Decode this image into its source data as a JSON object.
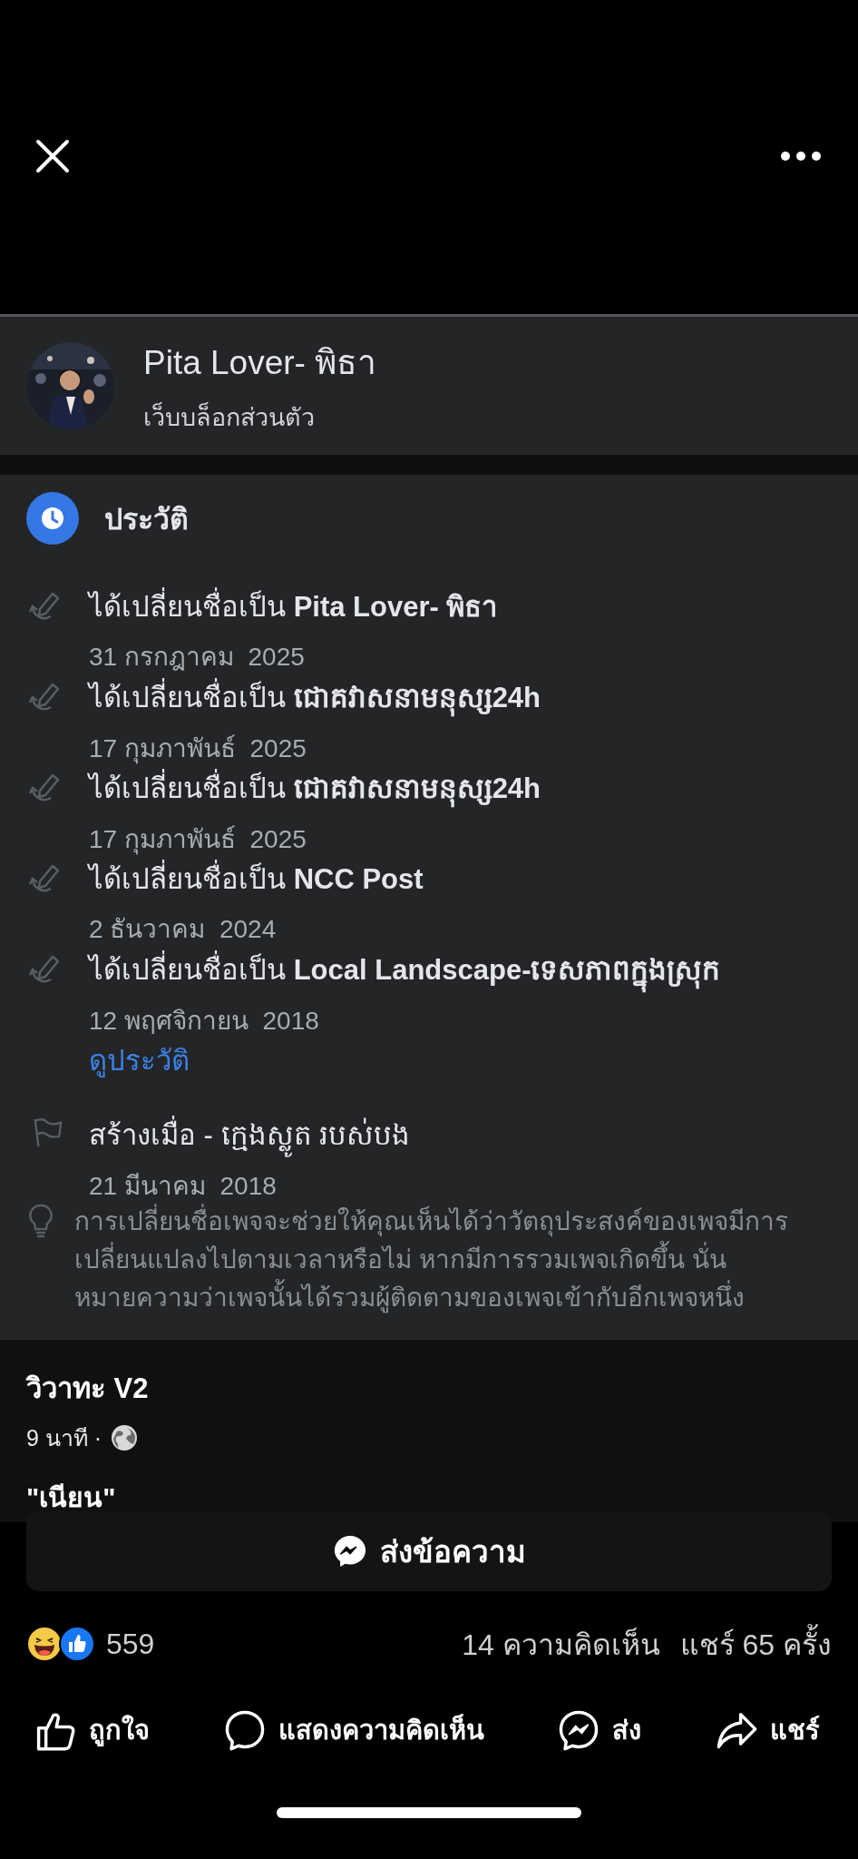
{
  "page_header": {
    "name": "Pita Lover- พิธา",
    "category": "เว็บบล็อกส่วนตัว"
  },
  "history": {
    "title": "ประวัติ",
    "entries": [
      {
        "kind": "rename",
        "text": "ได้เปลี่ยนชื่อเป็น **Pita Lover- พิธา**",
        "date": "31 กรกฎาคม  2025"
      },
      {
        "kind": "rename",
        "text": "ได้เปลี่ยนชื่อเป็น **ជោគវាសនាមនុស្ស24h**",
        "date": "17 กุมภาพันธ์  2025"
      },
      {
        "kind": "rename",
        "text": "ได้เปลี่ยนชื่อเป็น **ជោគវាសនាមនុស្ស24h**",
        "date": "17 กุมภาพันธ์  2025"
      },
      {
        "kind": "rename",
        "text": "ได้เปลี่ยนชื่อเป็น **NCC Post**",
        "date": "2 ธันวาคม  2024"
      },
      {
        "kind": "rename",
        "text": "ได้เปลี่ยนชื่อเป็น **Local Landscape-ទេសភាពក្នុងស្រុក**",
        "date": "12 พฤศจิกายน  2018"
      },
      {
        "kind": "link",
        "text": "ดูประวัติ"
      },
      {
        "kind": "created",
        "text": "สร้างเมื่อ - ក្មេងស្លូត របស់បង",
        "date": "21 มีนาคม  2018"
      }
    ],
    "hint": "การเปลี่ยนชื่อเพจจะช่วยให้คุณเห็นได้ว่าวัตถุประสงค์ของเพจมีการเปลี่ยนแปลงไปตามเวลาหรือไม่ หากมีการรวมเพจเกิดขึ้น นั่นหมายความว่าเพจนั้นได้รวมผู้ติดตามของเพจเข้ากับอีกเพจหนึ่ง"
  },
  "post": {
    "author": "วิวาทะ V2",
    "time": "9 นาที ·",
    "caption": "\"เนียน\""
  },
  "message_button": "ส่งข้อความ",
  "stats": {
    "reactions": "559",
    "comments": "14 ความคิดเห็น",
    "shares": "แชร์ 65 ครั้ง"
  },
  "actions": [
    {
      "kind": "like",
      "label": "ถูกใจ"
    },
    {
      "kind": "comment",
      "label": "แสดงความคิดเห็น"
    },
    {
      "kind": "send",
      "label": "ส่ง"
    },
    {
      "kind": "share",
      "label": "แชร์"
    }
  ]
}
